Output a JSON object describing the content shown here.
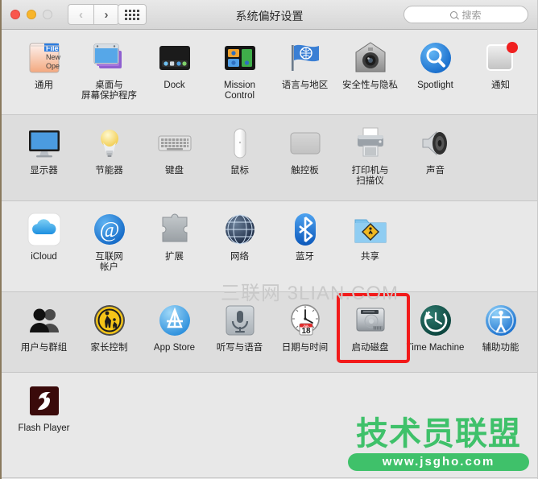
{
  "window": {
    "title": "系统偏好设置",
    "traffic_lights": [
      "close",
      "minimize",
      "zoom"
    ]
  },
  "toolbar": {
    "back_label": "‹",
    "forward_label": "›",
    "show_all_label": "show-all-grid"
  },
  "search": {
    "placeholder": "搜索",
    "value": ""
  },
  "colors": {
    "highlight_red": "#f21a1a",
    "watermark_green": "#3fc16a",
    "watermark_gray": "#c9c9c9",
    "window_bg": "#e6e6e6"
  },
  "rows": [
    {
      "shade": "a",
      "items": [
        {
          "label": "通用",
          "icon": "general-icon",
          "highlighted": false
        },
        {
          "label": "桌面与\n屏幕保护程序",
          "icon": "desktop-screensaver-icon",
          "highlighted": false
        },
        {
          "label": "Dock",
          "icon": "dock-icon",
          "highlighted": false
        },
        {
          "label": "Mission\nControl",
          "icon": "mission-control-icon",
          "highlighted": false
        },
        {
          "label": "语言与地区",
          "icon": "language-region-icon",
          "highlighted": false
        },
        {
          "label": "安全性与隐私",
          "icon": "security-privacy-icon",
          "highlighted": false
        },
        {
          "label": "Spotlight",
          "icon": "spotlight-icon",
          "highlighted": false
        },
        {
          "label": "通知",
          "icon": "notifications-icon",
          "highlighted": false
        }
      ]
    },
    {
      "shade": "b",
      "items": [
        {
          "label": "显示器",
          "icon": "displays-icon",
          "highlighted": false
        },
        {
          "label": "节能器",
          "icon": "energy-saver-icon",
          "highlighted": false
        },
        {
          "label": "键盘",
          "icon": "keyboard-icon",
          "highlighted": false
        },
        {
          "label": "鼠标",
          "icon": "mouse-icon",
          "highlighted": false
        },
        {
          "label": "触控板",
          "icon": "trackpad-icon",
          "highlighted": false
        },
        {
          "label": "打印机与\n扫描仪",
          "icon": "printers-scanners-icon",
          "highlighted": false
        },
        {
          "label": "声音",
          "icon": "sound-icon",
          "highlighted": false
        }
      ]
    },
    {
      "shade": "a",
      "items": [
        {
          "label": "iCloud",
          "icon": "icloud-icon",
          "highlighted": false
        },
        {
          "label": "互联网\n帐户",
          "icon": "internet-accounts-icon",
          "highlighted": false
        },
        {
          "label": "扩展",
          "icon": "extensions-icon",
          "highlighted": false
        },
        {
          "label": "网络",
          "icon": "network-icon",
          "highlighted": false
        },
        {
          "label": "蓝牙",
          "icon": "bluetooth-icon",
          "highlighted": false
        },
        {
          "label": "共享",
          "icon": "sharing-icon",
          "highlighted": false
        }
      ]
    },
    {
      "shade": "b",
      "items": [
        {
          "label": "用户与群组",
          "icon": "users-groups-icon",
          "highlighted": false
        },
        {
          "label": "家长控制",
          "icon": "parental-controls-icon",
          "highlighted": false
        },
        {
          "label": "App Store",
          "icon": "app-store-icon",
          "highlighted": false
        },
        {
          "label": "听写与语音",
          "icon": "dictation-speech-icon",
          "highlighted": false
        },
        {
          "label": "日期与时间",
          "icon": "date-time-icon",
          "highlighted": false
        },
        {
          "label": "启动磁盘",
          "icon": "startup-disk-icon",
          "highlighted": true
        },
        {
          "label": "Time Machine",
          "icon": "time-machine-icon",
          "highlighted": false
        },
        {
          "label": "辅助功能",
          "icon": "accessibility-icon",
          "highlighted": false
        }
      ]
    },
    {
      "shade": "a",
      "items": [
        {
          "label": "Flash Player",
          "icon": "flash-player-icon",
          "highlighted": false
        }
      ]
    }
  ],
  "watermarks": {
    "center": "三联网 3LIAN.COM",
    "corner_title": "技术员联盟",
    "corner_url": "www.jsgho.com"
  }
}
